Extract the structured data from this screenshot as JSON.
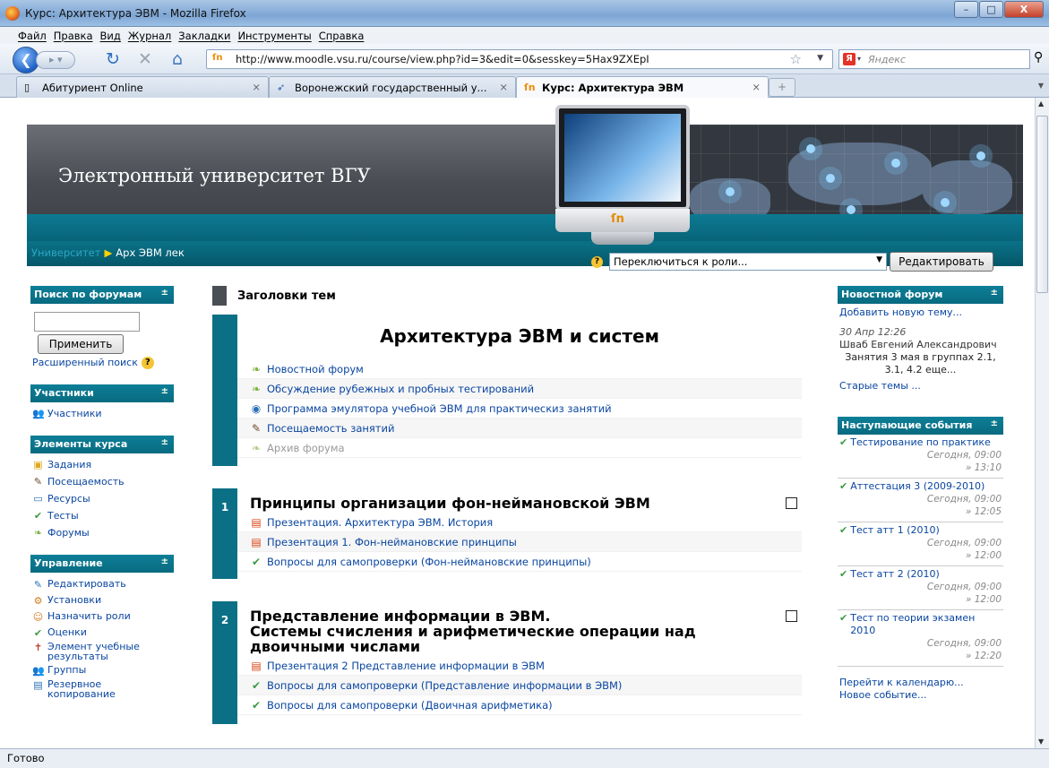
{
  "window": {
    "title": "Курс: Архитектура ЭВМ - Mozilla Firefox",
    "min": "–",
    "max": "□",
    "close": "X"
  },
  "menu": [
    "Файл",
    "Правка",
    "Вид",
    "Журнал",
    "Закладки",
    "Инструменты",
    "Справка"
  ],
  "nav": {
    "url": "http://www.moodle.vsu.ru/course/view.php?id=3&edit=0&sesskey=5Hax9ZXEpI",
    "search_placeholder": "Яндекс",
    "back_icon": "back-arrow-icon",
    "fav_icon": "moodle-icon"
  },
  "tabs": [
    {
      "label": "Абитуриент Online"
    },
    {
      "label": "Воронежский государственный у..."
    },
    {
      "label": "Курс: Архитектура ЭВМ"
    }
  ],
  "header": {
    "site_title": "Электронный университет ВГУ",
    "breadcrumb_root": "Университет",
    "breadcrumb_current": "Арх ЭВМ лек",
    "role_select": "Переключиться к роли...",
    "edit_button": "Редактировать"
  },
  "left": {
    "forum_search": {
      "title": "Поиск по форумам",
      "apply": "Применить",
      "advanced": "Расширенный поиск"
    },
    "participants": {
      "title": "Участники",
      "item": "Участники"
    },
    "course_elements": {
      "title": "Элементы курса",
      "items": [
        "Задания",
        "Посещаемость",
        "Ресурсы",
        "Тесты",
        "Форумы"
      ]
    },
    "admin": {
      "title": "Управление",
      "items": [
        "Редактировать",
        "Установки",
        "Назначить роли",
        "Оценки",
        "Элемент учебные результаты",
        "Группы",
        "Резервное копирование"
      ]
    }
  },
  "main": {
    "topics_header": "Заголовки тем",
    "section0": {
      "title": "Архитектура ЭВМ и систем",
      "items": [
        "Новостной форум",
        "Обсуждение рубежных и пробных тестирований",
        "Программа эмулятора учебной ЭВМ для практическиз занятий",
        "Посещаемость занятий",
        "Архив форума"
      ]
    },
    "section1": {
      "num": "1",
      "title": "Принципы организации фон-неймановской ЭВМ",
      "items": [
        "Презентация. Архитектура ЭВМ. История",
        "Презентация 1. Фон-неймановские принципы",
        "Вопросы для самопроверки (Фон-неймановские принципы)"
      ]
    },
    "section2": {
      "num": "2",
      "title_l1": "Представление информации в ЭВМ.",
      "title_l2": "Системы счисления и арифметические операции над",
      "title_l3": "двоичными числами",
      "items": [
        "Презентация 2 Представление информации в ЭВМ",
        "Вопросы для самопроверки (Представление информации в ЭВМ)",
        "Вопросы для самопроверки (Двоичная арифметика)"
      ]
    }
  },
  "right": {
    "news": {
      "title": "Новостной форум",
      "add": "Добавить новую тему...",
      "date": "30 Апр 12:26",
      "author": "Шваб Евгений Александрович",
      "text": "Занятия 3 мая в группах 2.1, 3.1, 4.2 еще...",
      "old": "Старые темы ..."
    },
    "events": {
      "title": "Наступающие события",
      "items": [
        {
          "name": "Тестирование по практике",
          "when": "Сегодня, 09:00",
          "end": "» 13:10"
        },
        {
          "name": "Аттестация 3 (2009-2010)",
          "when": "Сегодня, 09:00",
          "end": "» 12:05"
        },
        {
          "name": "Тест атт 1 (2010)",
          "when": "Сегодня, 09:00",
          "end": "» 12:00"
        },
        {
          "name": "Тест атт 2 (2010)",
          "when": "Сегодня, 09:00",
          "end": "» 12:00"
        },
        {
          "name": "Тест по теории экзамен 2010",
          "when": "Сегодня, 09:00",
          "end": "» 12:20"
        }
      ],
      "calendar": "Перейти к календарю...",
      "new_event": "Новое событие..."
    }
  },
  "status": "Готово"
}
